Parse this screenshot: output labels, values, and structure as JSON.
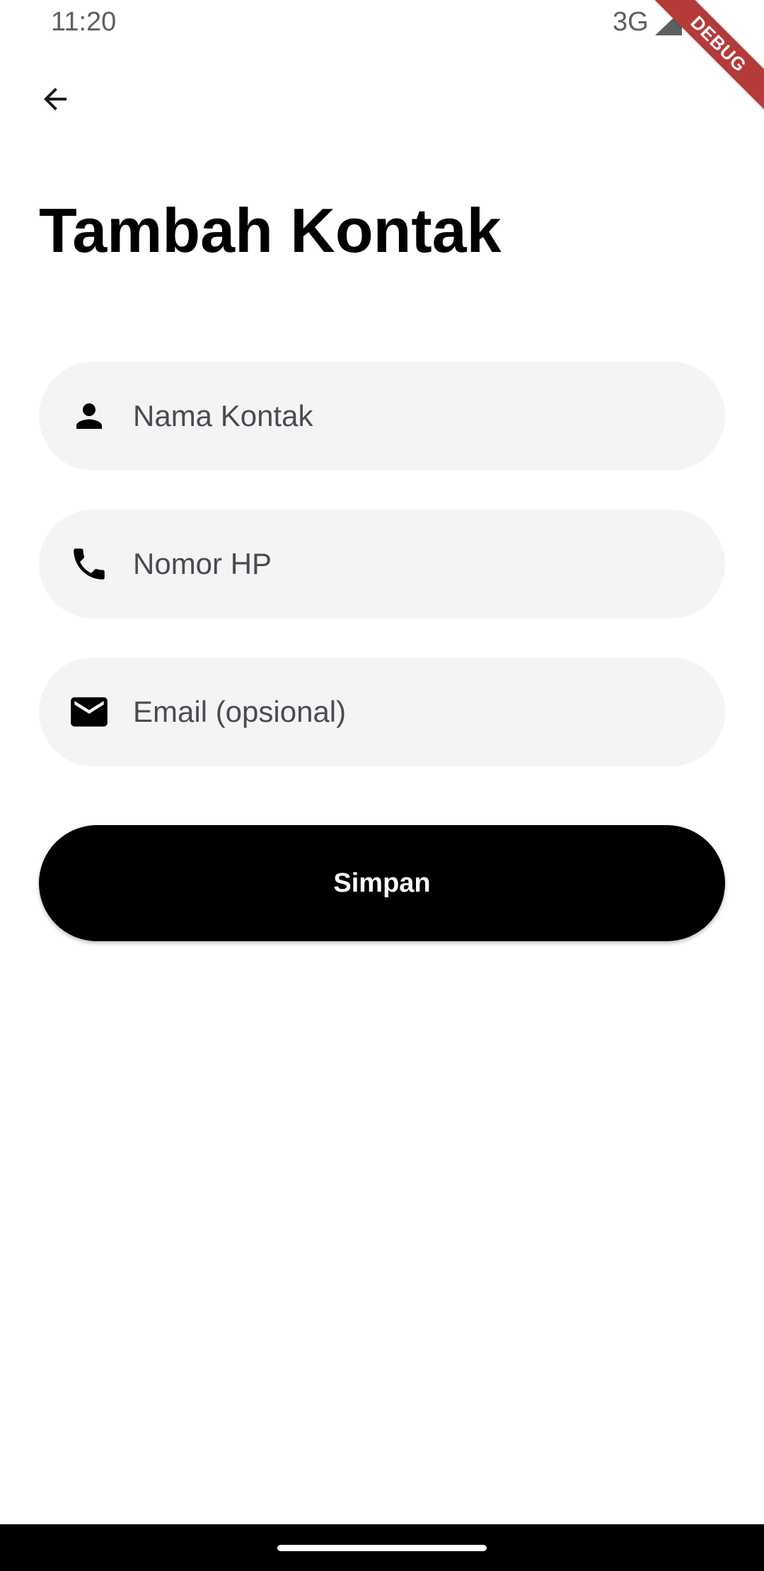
{
  "status_bar": {
    "time": "11:20",
    "network": "3G",
    "signal_icon": "signal-icon",
    "battery_icon": "battery-icon"
  },
  "debug_banner": {
    "label": "DEBUG",
    "color": "#b53a3a"
  },
  "header": {
    "back_icon": "arrow-left-icon",
    "title": "Tambah Kontak"
  },
  "form": {
    "fields": [
      {
        "icon": "person-icon",
        "placeholder": "Nama Kontak",
        "value": ""
      },
      {
        "icon": "phone-icon",
        "placeholder": "Nomor HP",
        "value": ""
      },
      {
        "icon": "mail-icon",
        "placeholder": "Email (opsional)",
        "value": ""
      }
    ],
    "submit_label": "Simpan"
  },
  "colors": {
    "background": "#ffffff",
    "field_background": "#f4f4f4",
    "primary_button": "#000000",
    "placeholder": "#4a4a54"
  }
}
